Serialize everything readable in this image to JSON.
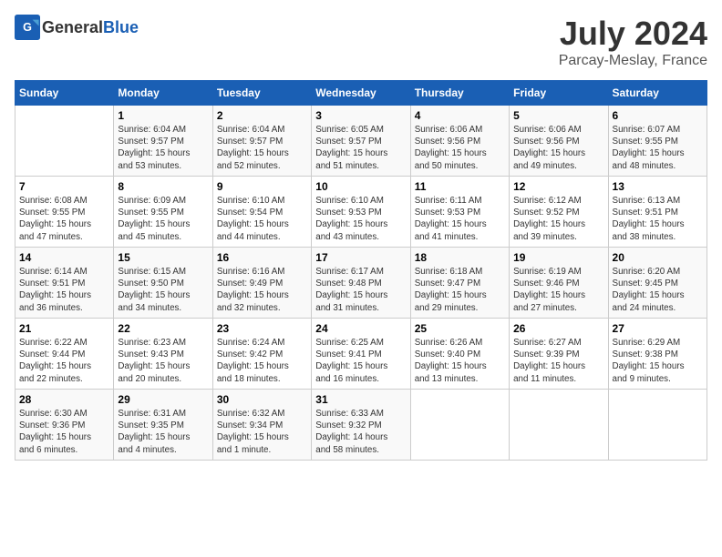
{
  "header": {
    "logo_general": "General",
    "logo_blue": "Blue",
    "month": "July 2024",
    "location": "Parcay-Meslay, France"
  },
  "days_of_week": [
    "Sunday",
    "Monday",
    "Tuesday",
    "Wednesday",
    "Thursday",
    "Friday",
    "Saturday"
  ],
  "weeks": [
    [
      {
        "day": "",
        "info": ""
      },
      {
        "day": "1",
        "info": "Sunrise: 6:04 AM\nSunset: 9:57 PM\nDaylight: 15 hours\nand 53 minutes."
      },
      {
        "day": "2",
        "info": "Sunrise: 6:04 AM\nSunset: 9:57 PM\nDaylight: 15 hours\nand 52 minutes."
      },
      {
        "day": "3",
        "info": "Sunrise: 6:05 AM\nSunset: 9:57 PM\nDaylight: 15 hours\nand 51 minutes."
      },
      {
        "day": "4",
        "info": "Sunrise: 6:06 AM\nSunset: 9:56 PM\nDaylight: 15 hours\nand 50 minutes."
      },
      {
        "day": "5",
        "info": "Sunrise: 6:06 AM\nSunset: 9:56 PM\nDaylight: 15 hours\nand 49 minutes."
      },
      {
        "day": "6",
        "info": "Sunrise: 6:07 AM\nSunset: 9:55 PM\nDaylight: 15 hours\nand 48 minutes."
      }
    ],
    [
      {
        "day": "7",
        "info": "Sunrise: 6:08 AM\nSunset: 9:55 PM\nDaylight: 15 hours\nand 47 minutes."
      },
      {
        "day": "8",
        "info": "Sunrise: 6:09 AM\nSunset: 9:55 PM\nDaylight: 15 hours\nand 45 minutes."
      },
      {
        "day": "9",
        "info": "Sunrise: 6:10 AM\nSunset: 9:54 PM\nDaylight: 15 hours\nand 44 minutes."
      },
      {
        "day": "10",
        "info": "Sunrise: 6:10 AM\nSunset: 9:53 PM\nDaylight: 15 hours\nand 43 minutes."
      },
      {
        "day": "11",
        "info": "Sunrise: 6:11 AM\nSunset: 9:53 PM\nDaylight: 15 hours\nand 41 minutes."
      },
      {
        "day": "12",
        "info": "Sunrise: 6:12 AM\nSunset: 9:52 PM\nDaylight: 15 hours\nand 39 minutes."
      },
      {
        "day": "13",
        "info": "Sunrise: 6:13 AM\nSunset: 9:51 PM\nDaylight: 15 hours\nand 38 minutes."
      }
    ],
    [
      {
        "day": "14",
        "info": "Sunrise: 6:14 AM\nSunset: 9:51 PM\nDaylight: 15 hours\nand 36 minutes."
      },
      {
        "day": "15",
        "info": "Sunrise: 6:15 AM\nSunset: 9:50 PM\nDaylight: 15 hours\nand 34 minutes."
      },
      {
        "day": "16",
        "info": "Sunrise: 6:16 AM\nSunset: 9:49 PM\nDaylight: 15 hours\nand 32 minutes."
      },
      {
        "day": "17",
        "info": "Sunrise: 6:17 AM\nSunset: 9:48 PM\nDaylight: 15 hours\nand 31 minutes."
      },
      {
        "day": "18",
        "info": "Sunrise: 6:18 AM\nSunset: 9:47 PM\nDaylight: 15 hours\nand 29 minutes."
      },
      {
        "day": "19",
        "info": "Sunrise: 6:19 AM\nSunset: 9:46 PM\nDaylight: 15 hours\nand 27 minutes."
      },
      {
        "day": "20",
        "info": "Sunrise: 6:20 AM\nSunset: 9:45 PM\nDaylight: 15 hours\nand 24 minutes."
      }
    ],
    [
      {
        "day": "21",
        "info": "Sunrise: 6:22 AM\nSunset: 9:44 PM\nDaylight: 15 hours\nand 22 minutes."
      },
      {
        "day": "22",
        "info": "Sunrise: 6:23 AM\nSunset: 9:43 PM\nDaylight: 15 hours\nand 20 minutes."
      },
      {
        "day": "23",
        "info": "Sunrise: 6:24 AM\nSunset: 9:42 PM\nDaylight: 15 hours\nand 18 minutes."
      },
      {
        "day": "24",
        "info": "Sunrise: 6:25 AM\nSunset: 9:41 PM\nDaylight: 15 hours\nand 16 minutes."
      },
      {
        "day": "25",
        "info": "Sunrise: 6:26 AM\nSunset: 9:40 PM\nDaylight: 15 hours\nand 13 minutes."
      },
      {
        "day": "26",
        "info": "Sunrise: 6:27 AM\nSunset: 9:39 PM\nDaylight: 15 hours\nand 11 minutes."
      },
      {
        "day": "27",
        "info": "Sunrise: 6:29 AM\nSunset: 9:38 PM\nDaylight: 15 hours\nand 9 minutes."
      }
    ],
    [
      {
        "day": "28",
        "info": "Sunrise: 6:30 AM\nSunset: 9:36 PM\nDaylight: 15 hours\nand 6 minutes."
      },
      {
        "day": "29",
        "info": "Sunrise: 6:31 AM\nSunset: 9:35 PM\nDaylight: 15 hours\nand 4 minutes."
      },
      {
        "day": "30",
        "info": "Sunrise: 6:32 AM\nSunset: 9:34 PM\nDaylight: 15 hours\nand 1 minute."
      },
      {
        "day": "31",
        "info": "Sunrise: 6:33 AM\nSunset: 9:32 PM\nDaylight: 14 hours\nand 58 minutes."
      },
      {
        "day": "",
        "info": ""
      },
      {
        "day": "",
        "info": ""
      },
      {
        "day": "",
        "info": ""
      }
    ]
  ]
}
